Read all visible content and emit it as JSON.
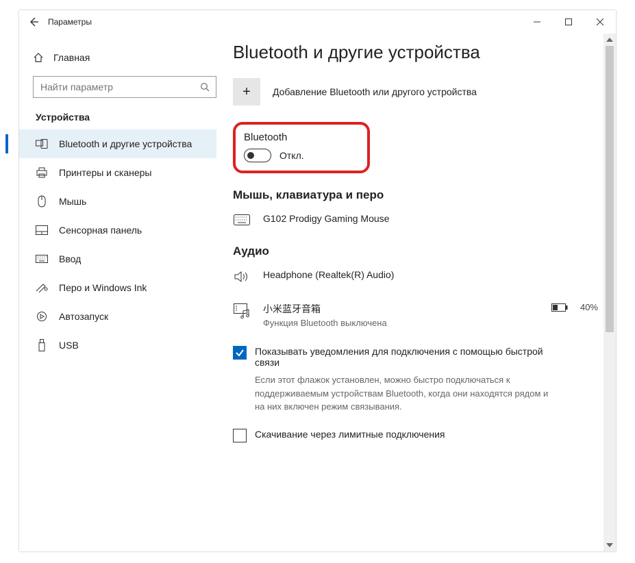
{
  "window": {
    "title": "Параметры"
  },
  "sidebar": {
    "home": "Главная",
    "search_placeholder": "Найти параметр",
    "section": "Устройства",
    "items": [
      {
        "label": "Bluetooth и другие устройства"
      },
      {
        "label": "Принтеры и сканеры"
      },
      {
        "label": "Мышь"
      },
      {
        "label": "Сенсорная панель"
      },
      {
        "label": "Ввод"
      },
      {
        "label": "Перо и Windows Ink"
      },
      {
        "label": "Автозапуск"
      },
      {
        "label": "USB"
      }
    ]
  },
  "main": {
    "heading": "Bluetooth и другие устройства",
    "add_device": "Добавление Bluetooth или другого устройства",
    "bluetooth_label": "Bluetooth",
    "bluetooth_state": "Откл.",
    "section_mkp": "Мышь, клавиатура и перо",
    "mouse_name": "G102 Prodigy Gaming Mouse",
    "section_audio": "Аудио",
    "headphone_name": "Headphone (Realtek(R) Audio)",
    "speaker_name": "小米蓝牙音箱",
    "speaker_sub": "Функция Bluetooth выключена",
    "battery_pct": "40%",
    "notify_label": "Показывать уведомления для подключения с помощью быстрой связи",
    "notify_desc": "Если этот флажок установлен, можно быстро подключаться к поддерживаемым устройствам Bluetooth, когда они находятся рядом и на них включен режим связывания.",
    "metered_label": "Скачивание через лимитные подключения"
  }
}
